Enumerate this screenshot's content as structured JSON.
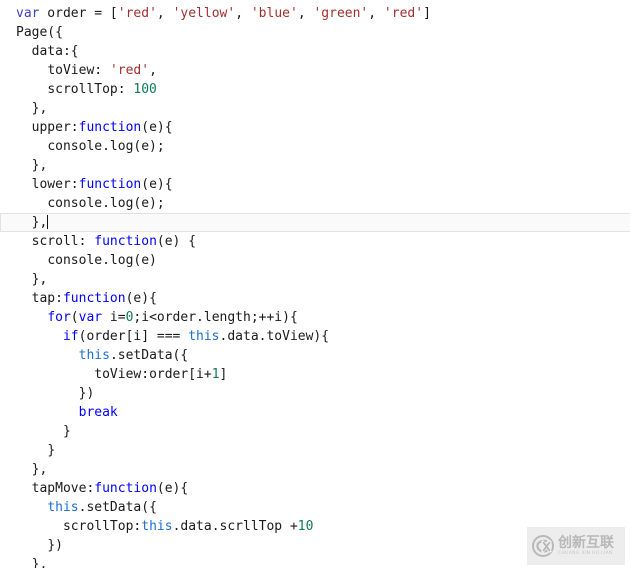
{
  "editor": {
    "language": "javascript",
    "background_color": "#ffffff",
    "font_size_px": 13,
    "line_height_px": 19,
    "active_line_index": 10,
    "cursor": {
      "line": 10,
      "column": 5,
      "visible": true
    },
    "colors": {
      "text": "#1a1a1a",
      "keyword": "#0000ff",
      "variable_keyword": "#4040c0",
      "string": "#a03030",
      "number": "#0e7a54",
      "this_keyword": "#1a6fd4",
      "active_line_background": "#fafafa",
      "active_line_border": "#e2e2e2"
    },
    "lines": [
      {
        "indent": 0,
        "tokens": [
          {
            "t": "var",
            "c": "var"
          },
          {
            "t": " order = [",
            "c": "plain"
          },
          {
            "t": "'red'",
            "c": "str"
          },
          {
            "t": ", ",
            "c": "plain"
          },
          {
            "t": "'yellow'",
            "c": "str"
          },
          {
            "t": ", ",
            "c": "plain"
          },
          {
            "t": "'blue'",
            "c": "str"
          },
          {
            "t": ", ",
            "c": "plain"
          },
          {
            "t": "'green'",
            "c": "str"
          },
          {
            "t": ", ",
            "c": "plain"
          },
          {
            "t": "'red'",
            "c": "str"
          },
          {
            "t": "]",
            "c": "plain"
          }
        ]
      },
      {
        "indent": 0,
        "tokens": [
          {
            "t": "Page({",
            "c": "plain"
          }
        ]
      },
      {
        "indent": 1,
        "tokens": [
          {
            "t": "data:{",
            "c": "plain"
          }
        ]
      },
      {
        "indent": 2,
        "tokens": [
          {
            "t": "toView: ",
            "c": "plain"
          },
          {
            "t": "'red'",
            "c": "str"
          },
          {
            "t": ",",
            "c": "plain"
          }
        ]
      },
      {
        "indent": 2,
        "tokens": [
          {
            "t": "scrollTop: ",
            "c": "plain"
          },
          {
            "t": "100",
            "c": "num"
          }
        ]
      },
      {
        "indent": 1,
        "tokens": [
          {
            "t": "},",
            "c": "plain"
          }
        ]
      },
      {
        "indent": 1,
        "tokens": [
          {
            "t": "upper:",
            "c": "plain"
          },
          {
            "t": "function",
            "c": "fn"
          },
          {
            "t": "(e){",
            "c": "plain"
          }
        ]
      },
      {
        "indent": 2,
        "tokens": [
          {
            "t": "console.log(e);",
            "c": "plain"
          }
        ]
      },
      {
        "indent": 1,
        "tokens": [
          {
            "t": "},",
            "c": "plain"
          }
        ]
      },
      {
        "indent": 1,
        "tokens": [
          {
            "t": "lower:",
            "c": "plain"
          },
          {
            "t": "function",
            "c": "fn"
          },
          {
            "t": "(e){",
            "c": "plain"
          }
        ]
      },
      {
        "indent": 2,
        "tokens": [
          {
            "t": "console.log(e);",
            "c": "plain"
          }
        ]
      },
      {
        "indent": 1,
        "active": true,
        "tokens": [
          {
            "t": "},",
            "c": "plain"
          }
        ]
      },
      {
        "indent": 1,
        "tokens": [
          {
            "t": "scroll: ",
            "c": "plain"
          },
          {
            "t": "function",
            "c": "fn"
          },
          {
            "t": "(e) {",
            "c": "plain"
          }
        ]
      },
      {
        "indent": 2,
        "tokens": [
          {
            "t": "console.log(e)",
            "c": "plain"
          }
        ]
      },
      {
        "indent": 1,
        "tokens": [
          {
            "t": "},",
            "c": "plain"
          }
        ]
      },
      {
        "indent": 1,
        "tokens": [
          {
            "t": "tap:",
            "c": "plain"
          },
          {
            "t": "function",
            "c": "fn"
          },
          {
            "t": "(e){",
            "c": "plain"
          }
        ]
      },
      {
        "indent": 2,
        "tokens": [
          {
            "t": "for",
            "c": "key"
          },
          {
            "t": "(",
            "c": "plain"
          },
          {
            "t": "var",
            "c": "key"
          },
          {
            "t": " i=",
            "c": "plain"
          },
          {
            "t": "0",
            "c": "num"
          },
          {
            "t": ";i<order.length;++i){",
            "c": "plain"
          }
        ]
      },
      {
        "indent": 3,
        "tokens": [
          {
            "t": "if",
            "c": "key"
          },
          {
            "t": "(order[i] === ",
            "c": "plain"
          },
          {
            "t": "this",
            "c": "this"
          },
          {
            "t": ".data.toView){",
            "c": "plain"
          }
        ]
      },
      {
        "indent": 4,
        "tokens": [
          {
            "t": "this",
            "c": "this"
          },
          {
            "t": ".setData({",
            "c": "plain"
          }
        ]
      },
      {
        "indent": 5,
        "tokens": [
          {
            "t": "toView:order[i+",
            "c": "plain"
          },
          {
            "t": "1",
            "c": "num"
          },
          {
            "t": "]",
            "c": "plain"
          }
        ]
      },
      {
        "indent": 4,
        "tokens": [
          {
            "t": "})",
            "c": "plain"
          }
        ]
      },
      {
        "indent": 4,
        "tokens": [
          {
            "t": "break",
            "c": "key"
          }
        ]
      },
      {
        "indent": 3,
        "tokens": [
          {
            "t": "}",
            "c": "plain"
          }
        ]
      },
      {
        "indent": 2,
        "tokens": [
          {
            "t": "}",
            "c": "plain"
          }
        ]
      },
      {
        "indent": 1,
        "tokens": [
          {
            "t": "},",
            "c": "plain"
          }
        ]
      },
      {
        "indent": 1,
        "tokens": [
          {
            "t": "tapMove:",
            "c": "plain"
          },
          {
            "t": "function",
            "c": "fn"
          },
          {
            "t": "(e){",
            "c": "plain"
          }
        ]
      },
      {
        "indent": 2,
        "tokens": [
          {
            "t": "this",
            "c": "this"
          },
          {
            "t": ".setData({",
            "c": "plain"
          }
        ]
      },
      {
        "indent": 3,
        "tokens": [
          {
            "t": "scrollTop:",
            "c": "plain"
          },
          {
            "t": "this",
            "c": "this"
          },
          {
            "t": ".data.scrllTop +",
            "c": "plain"
          },
          {
            "t": "10",
            "c": "num"
          }
        ]
      },
      {
        "indent": 2,
        "tokens": [
          {
            "t": "})",
            "c": "plain"
          }
        ]
      },
      {
        "indent": 1,
        "tokens": [
          {
            "t": "},",
            "c": "plain"
          }
        ]
      }
    ]
  },
  "watermark": {
    "logo_text": "CX",
    "brand_cn": "创新互联",
    "brand_en": "CHUANG XIN HU LIAN",
    "background_color": "#ededed",
    "text_color": "#b5b5b5"
  }
}
